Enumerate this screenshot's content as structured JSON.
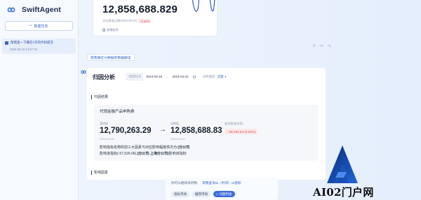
{
  "sidebar": {
    "app_name": "SwiftAgent",
    "new_task_label": "新建任务",
    "history": [
      {
        "title": "帮我查一下最近7天的代码提交",
        "time": "2024-03-22 14:57:16"
      }
    ]
  },
  "top_card": {
    "value": "12,858,688.829",
    "compare_text": "对比基准日期(2024-03-21)",
    "compare_pct": "↑2.24%",
    "view_label": "查看趋势"
  },
  "suggestion": "帮我做近分数据的数据解读",
  "analysis": {
    "title": "归因分析",
    "date_label": "归因时间",
    "start_date": "2024-03-16",
    "separator": "→",
    "end_date": "2024-03-22",
    "dimension_label": "分析维度",
    "dimension_value": "全部",
    "section_result": "归因结果",
    "product_name": "代销金融产品申购费",
    "base_label": "基期值",
    "base_value": "12,790,263.29",
    "base_date": "2024-03-16",
    "current_label": "现期值",
    "current_value": "12,858,688.83",
    "current_date": "2024-03-22",
    "change_label": "变化量(变化率)",
    "change_value": "↑ 68,425.54 (0.53%)",
    "insight_line1_prefix": "影响指标名称的前三大因素与对应影响幅度依次为:",
    "insight_line1_bold": "(分公司",
    "insight_line2_prefix": "影响该指标(-57,535.06),",
    "insight_line2_bold": "(分公司-上海分公司)",
    "insight_line2_suffix": "影响该指标",
    "section_factors": "影响因素"
  },
  "followup": {
    "prompt": "你可以继续询问我:",
    "link1": "帮我查询xx（时间）xx指标",
    "buttons": [
      "指标市场",
      "推荐市场",
      "问题列表"
    ]
  },
  "watermark": {
    "text": "AI02门户网"
  },
  "colors": {
    "accent": "#3c6fdf",
    "negative": "#d94a56"
  }
}
